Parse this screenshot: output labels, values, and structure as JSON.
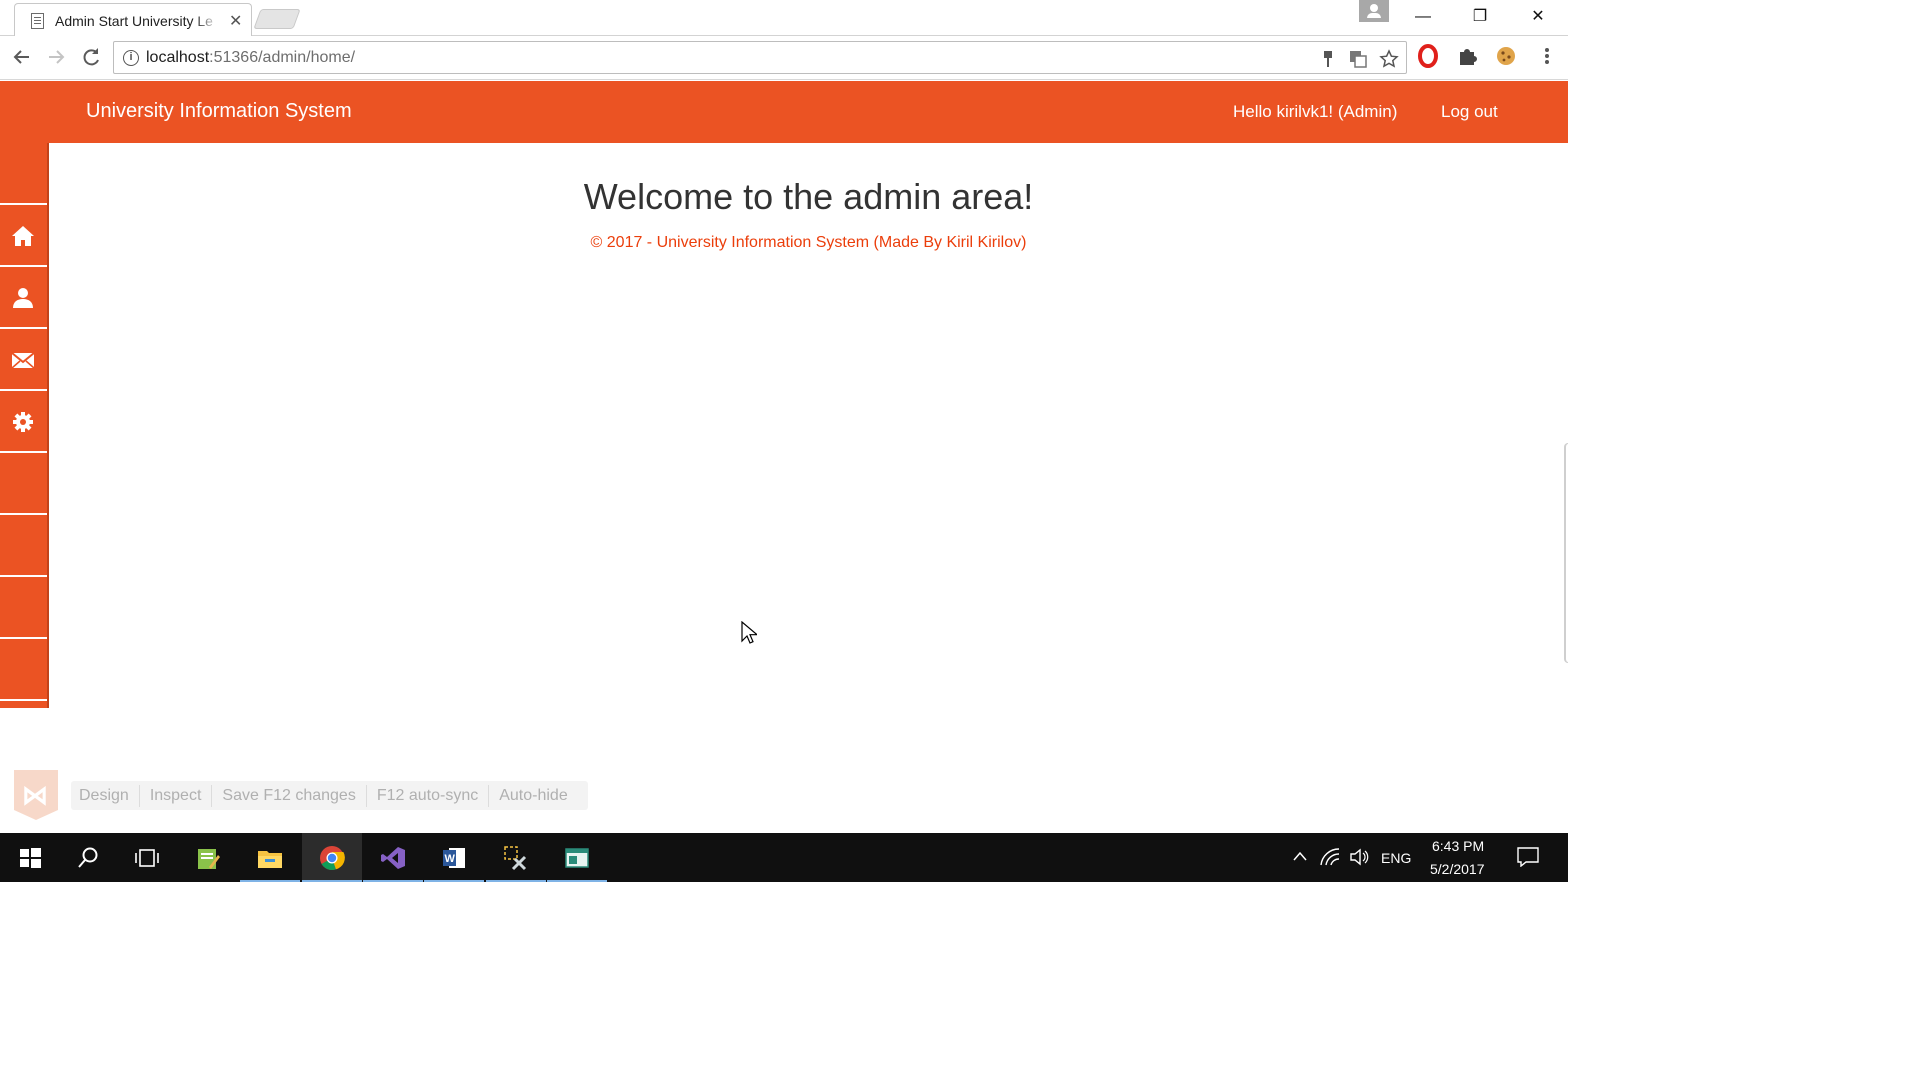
{
  "browser": {
    "tab_title": "Admin Start University Le",
    "tab_close": "✕",
    "url_host": "localhost",
    "url_rest": ":51366/admin/home/",
    "window_controls": {
      "minimize": "—",
      "restore": "❐",
      "close": "✕"
    },
    "nav_icons": [
      "back-arrow-icon",
      "forward-arrow-icon",
      "reload-icon"
    ],
    "omnibox_icons": [
      "key-icon",
      "translate-icon",
      "star-icon"
    ],
    "extension_icons": [
      "opera-icon",
      "puzzle-icon",
      "cookie-icon",
      "menu-dots-icon"
    ]
  },
  "site": {
    "brand": "University Information System",
    "greeting": "Hello kirilvk1! (Admin)",
    "logout": "Log out",
    "accent_color": "#eb5323"
  },
  "sidebar": {
    "items": [
      {
        "icon": ""
      },
      {
        "icon": "home-icon"
      },
      {
        "icon": "user-icon"
      },
      {
        "icon": "envelope-icon"
      },
      {
        "icon": "gear-icon"
      },
      {
        "icon": ""
      },
      {
        "icon": ""
      },
      {
        "icon": ""
      },
      {
        "icon": ""
      }
    ]
  },
  "main": {
    "heading": "Welcome to the admin area!",
    "footer": "© 2017 - University Information System (Made By Kiril Kirilov)"
  },
  "browser_link": {
    "buttons": [
      "Design",
      "Inspect",
      "Save F12 changes",
      "F12 auto-sync",
      "Auto-hide"
    ]
  },
  "taskbar": {
    "apps": [
      "start-icon",
      "search-icon",
      "task-view-icon",
      "notepad-icon",
      "file-explorer-icon",
      "chrome-icon",
      "visual-studio-icon",
      "word-icon",
      "tools-icon",
      "window-app-icon"
    ],
    "language": "ENG",
    "time": "6:43 PM",
    "date": "5/2/2017"
  }
}
